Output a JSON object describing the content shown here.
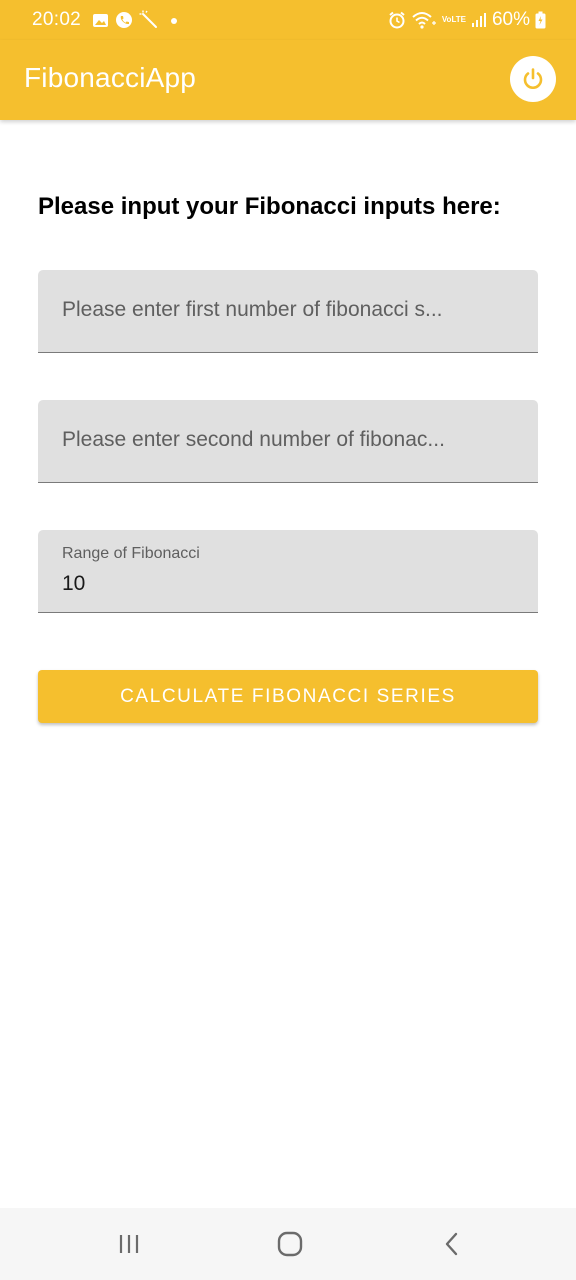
{
  "status_bar": {
    "time": "20:02",
    "battery": "60%",
    "network": "VoLTE",
    "icons": [
      "gallery-icon",
      "whatsapp-icon",
      "magic-wand-icon",
      "dot-icon",
      "alarm-icon",
      "wifi-icon",
      "signal-icon",
      "battery-icon"
    ]
  },
  "app_bar": {
    "title": "FibonacciApp",
    "action_icon": "power-icon"
  },
  "form": {
    "heading": "Please input your Fibonacci inputs here:",
    "first_number": {
      "placeholder": "Please enter first number of fibonacci s...",
      "value": ""
    },
    "second_number": {
      "placeholder": "Please enter second number of fibonac...",
      "value": ""
    },
    "range": {
      "label": "Range of Fibonacci",
      "value": "10"
    },
    "submit_label": "CALCULATE FIBONACCI SERIES"
  },
  "nav_bar": {
    "buttons": [
      "recents-icon",
      "home-icon",
      "back-icon"
    ]
  },
  "colors": {
    "primary": "#f5bf2e",
    "field_background": "#e0e0e0",
    "nav_background": "#f6f6f6"
  }
}
